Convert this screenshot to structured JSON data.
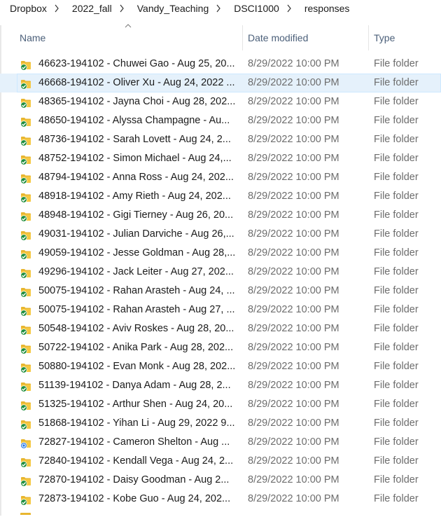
{
  "breadcrumb": [
    "Dropbox",
    "2022_fall",
    "Vandy_Teaching",
    "DSCI1000",
    "responses"
  ],
  "columns": {
    "name": "Name",
    "date_modified": "Date modified",
    "type": "Type"
  },
  "colors": {
    "folder": "#e8b630",
    "synced": "#1e8e3e",
    "syncing": "#1a73e8",
    "selected_row": "#e5f1fb"
  },
  "files": [
    {
      "name": "46623-194102 - Chuwei Gao - Aug 25, 20...",
      "date": "8/29/2022 10:00 PM",
      "type": "File folder",
      "status": "synced"
    },
    {
      "name": "46668-194102 - Oliver Xu - Aug 24, 2022 ...",
      "date": "8/29/2022 10:00 PM",
      "type": "File folder",
      "status": "synced",
      "selected": true
    },
    {
      "name": "48365-194102 - Jayna Choi - Aug 28, 202...",
      "date": "8/29/2022 10:00 PM",
      "type": "File folder",
      "status": "synced"
    },
    {
      "name": "48650-194102 - Alyssa Champagne - Au...",
      "date": "8/29/2022 10:00 PM",
      "type": "File folder",
      "status": "synced"
    },
    {
      "name": "48736-194102 - Sarah Lovett - Aug 24, 2...",
      "date": "8/29/2022 10:00 PM",
      "type": "File folder",
      "status": "synced"
    },
    {
      "name": "48752-194102 - Simon Michael - Aug 24,...",
      "date": "8/29/2022 10:00 PM",
      "type": "File folder",
      "status": "synced"
    },
    {
      "name": "48794-194102 - Anna Ross - Aug 24, 202...",
      "date": "8/29/2022 10:00 PM",
      "type": "File folder",
      "status": "synced"
    },
    {
      "name": "48918-194102 - Amy Rieth - Aug 24, 202...",
      "date": "8/29/2022 10:00 PM",
      "type": "File folder",
      "status": "synced"
    },
    {
      "name": "48948-194102 - Gigi Tierney - Aug 26, 20...",
      "date": "8/29/2022 10:00 PM",
      "type": "File folder",
      "status": "synced"
    },
    {
      "name": "49031-194102 - Julian Darviche - Aug 26,...",
      "date": "8/29/2022 10:00 PM",
      "type": "File folder",
      "status": "synced"
    },
    {
      "name": "49059-194102 - Jesse Goldman - Aug 28,...",
      "date": "8/29/2022 10:00 PM",
      "type": "File folder",
      "status": "synced"
    },
    {
      "name": "49296-194102 - Jack Leiter - Aug 27, 202...",
      "date": "8/29/2022 10:00 PM",
      "type": "File folder",
      "status": "synced"
    },
    {
      "name": "50075-194102 - Rahan Arasteh - Aug 24, ...",
      "date": "8/29/2022 10:00 PM",
      "type": "File folder",
      "status": "synced"
    },
    {
      "name": "50075-194102 - Rahan Arasteh - Aug 27, ...",
      "date": "8/29/2022 10:00 PM",
      "type": "File folder",
      "status": "synced"
    },
    {
      "name": "50548-194102 - Aviv Roskes - Aug 28, 20...",
      "date": "8/29/2022 10:00 PM",
      "type": "File folder",
      "status": "synced"
    },
    {
      "name": "50722-194102 - Anika Park - Aug 28, 202...",
      "date": "8/29/2022 10:00 PM",
      "type": "File folder",
      "status": "synced"
    },
    {
      "name": "50880-194102 - Evan Monk - Aug 28, 202...",
      "date": "8/29/2022 10:00 PM",
      "type": "File folder",
      "status": "synced"
    },
    {
      "name": "51139-194102 - Danya Adam - Aug 28, 2...",
      "date": "8/29/2022 10:00 PM",
      "type": "File folder",
      "status": "synced"
    },
    {
      "name": "51325-194102 - Arthur Shen - Aug 24, 20...",
      "date": "8/29/2022 10:00 PM",
      "type": "File folder",
      "status": "synced"
    },
    {
      "name": "51868-194102 - Yihan Li - Aug 29, 2022 9...",
      "date": "8/29/2022 10:00 PM",
      "type": "File folder",
      "status": "synced"
    },
    {
      "name": "72827-194102 - Cameron Shelton - Aug ...",
      "date": "8/29/2022 10:00 PM",
      "type": "File folder",
      "status": "syncing"
    },
    {
      "name": "72840-194102 - Kendall Vega - Aug 24, 2...",
      "date": "8/29/2022 10:00 PM",
      "type": "File folder",
      "status": "synced"
    },
    {
      "name": "72870-194102 - Daisy Goodman - Aug 2...",
      "date": "8/29/2022 10:00 PM",
      "type": "File folder",
      "status": "synced"
    },
    {
      "name": "72873-194102 - Kobe Guo - Aug 24, 202...",
      "date": "8/29/2022 10:00 PM",
      "type": "File folder",
      "status": "synced"
    }
  ]
}
